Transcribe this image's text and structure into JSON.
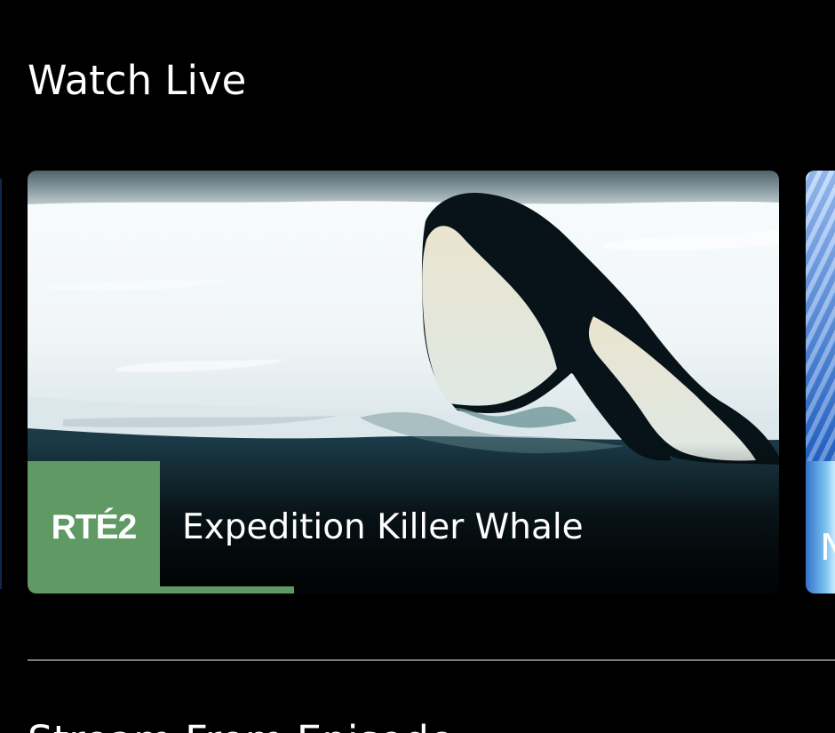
{
  "section": {
    "title": "Watch Live"
  },
  "featured_live": {
    "channel": "RTÉ2",
    "program": "Expedition Killer Whale",
    "progress_percent": 21.6
  },
  "next_live": {
    "partial_title": "N"
  },
  "next_section": {
    "partial_title": "Stream From Episode"
  }
}
